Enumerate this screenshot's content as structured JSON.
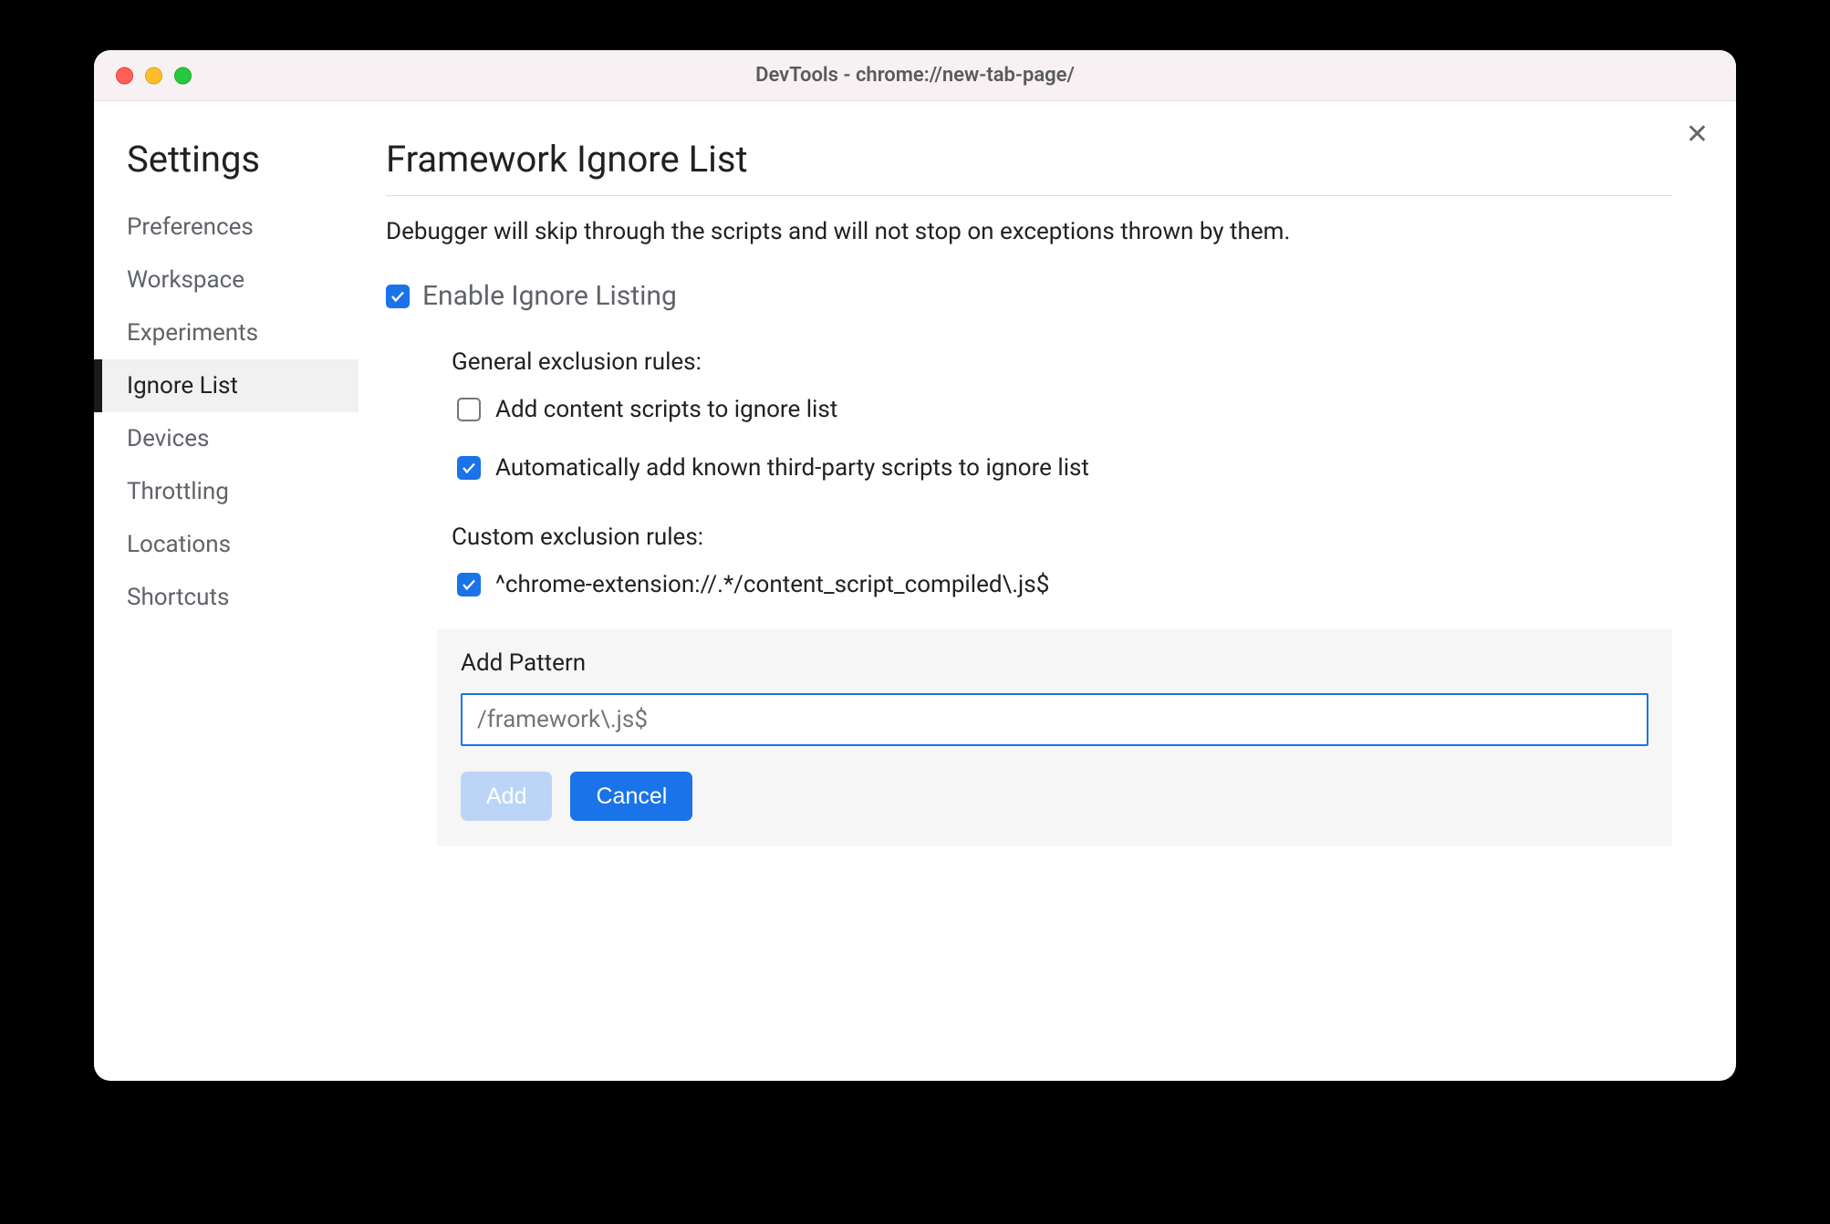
{
  "window": {
    "title": "DevTools - chrome://new-tab-page/"
  },
  "sidebar": {
    "title": "Settings",
    "items": [
      {
        "label": "Preferences",
        "active": false
      },
      {
        "label": "Workspace",
        "active": false
      },
      {
        "label": "Experiments",
        "active": false
      },
      {
        "label": "Ignore List",
        "active": true
      },
      {
        "label": "Devices",
        "active": false
      },
      {
        "label": "Throttling",
        "active": false
      },
      {
        "label": "Locations",
        "active": false
      },
      {
        "label": "Shortcuts",
        "active": false
      }
    ]
  },
  "main": {
    "title": "Framework Ignore List",
    "description": "Debugger will skip through the scripts and will not stop on exceptions thrown by them.",
    "enable_label": "Enable Ignore Listing",
    "enable_checked": true,
    "general": {
      "title": "General exclusion rules:",
      "options": [
        {
          "label": "Add content scripts to ignore list",
          "checked": false
        },
        {
          "label": "Automatically add known third-party scripts to ignore list",
          "checked": true
        }
      ]
    },
    "custom": {
      "title": "Custom exclusion rules:",
      "patterns": [
        {
          "label": "^chrome-extension://.*/content_script_compiled\\.js$",
          "checked": true
        }
      ]
    },
    "add_pattern": {
      "label": "Add Pattern",
      "placeholder": "/framework\\.js$",
      "add_button": "Add",
      "cancel_button": "Cancel"
    }
  }
}
